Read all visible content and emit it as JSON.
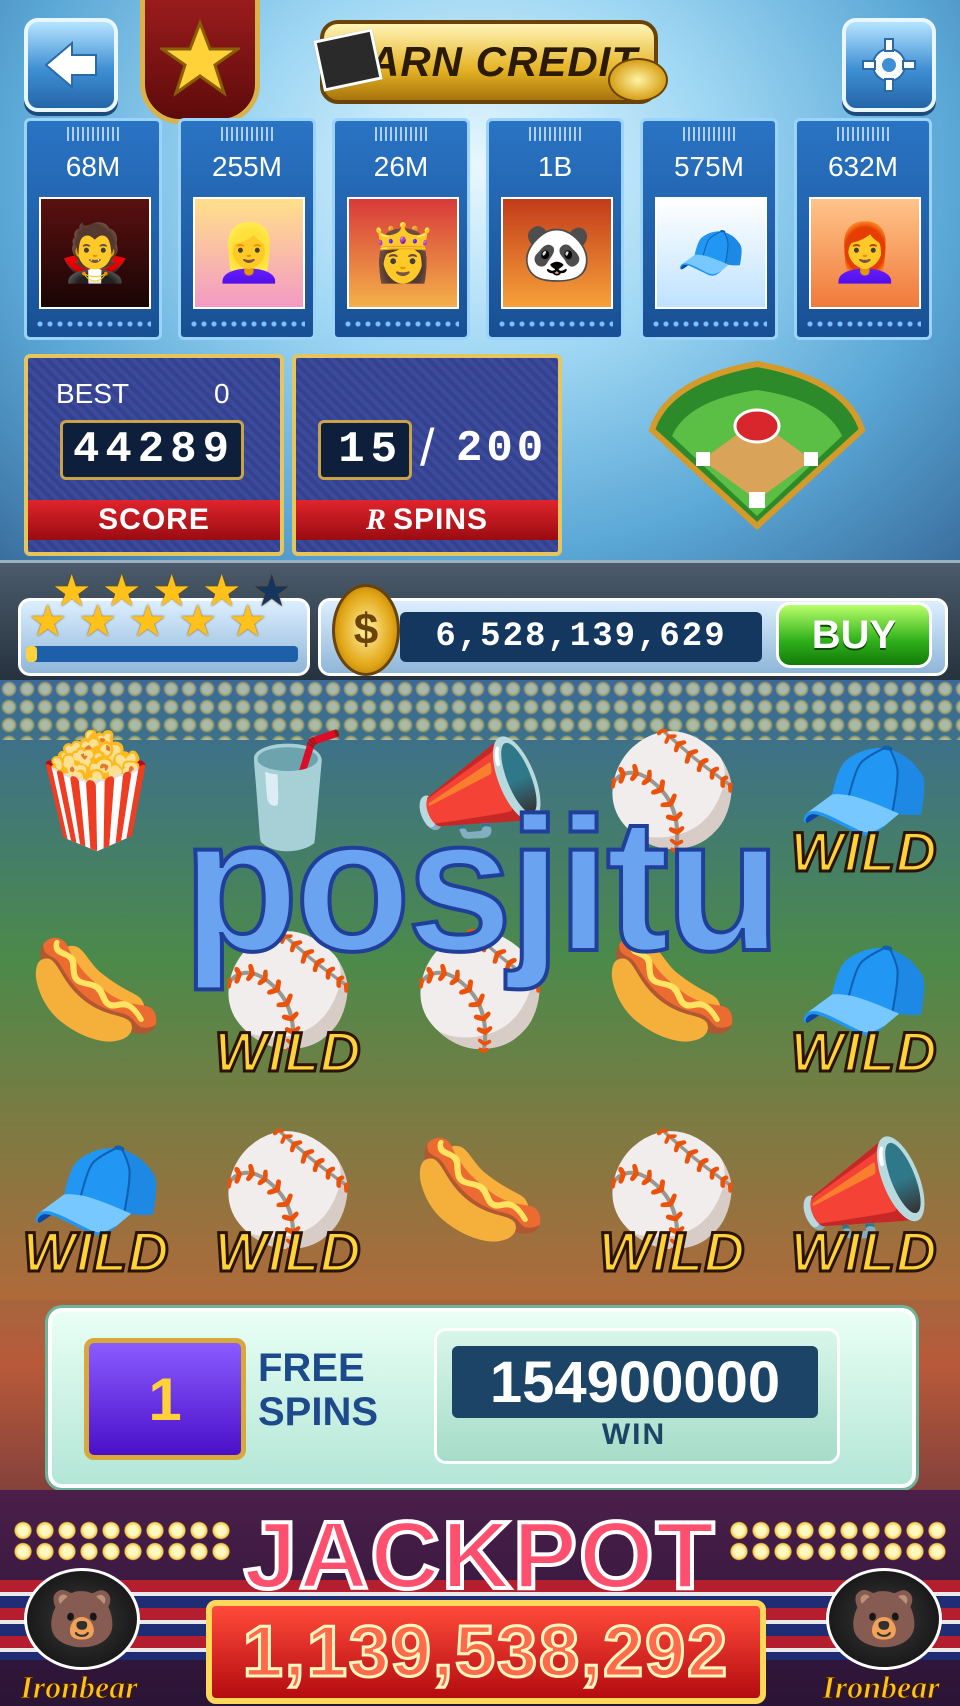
{
  "header": {
    "back_icon": "back-arrow-icon",
    "rank_icon": "star-shield-icon",
    "earn_credit_label": "EARN CREDIT",
    "settings_icon": "gear-icon"
  },
  "players": [
    {
      "amount": "68M",
      "avatar": "vampire-avatar"
    },
    {
      "amount": "255M",
      "avatar": "blonde-girl-avatar"
    },
    {
      "amount": "26M",
      "avatar": "princess-avatar"
    },
    {
      "amount": "1B",
      "avatar": "panda-avatar"
    },
    {
      "amount": "575M",
      "avatar": "baseball-boy-avatar"
    },
    {
      "amount": "632M",
      "avatar": "redhead-girl-avatar"
    }
  ],
  "score": {
    "best_label": "BEST",
    "best_value": "0",
    "value": "44289",
    "label": "SCORE"
  },
  "spins": {
    "current": "15",
    "separator": "/",
    "total": "200",
    "label": "SPINS"
  },
  "level": {
    "stars_filled": 9,
    "stars_total": 10,
    "progress": 0.04
  },
  "credits": {
    "value": "6,528,139,629",
    "buy_label": "BUY"
  },
  "reels": [
    [
      {
        "sym": "🍿"
      },
      {
        "sym": "🥤"
      },
      {
        "sym": "📣"
      },
      {
        "sym": "⚾"
      },
      {
        "sym": "🧢",
        "wild": "WILD"
      }
    ],
    [
      {
        "sym": "🌭"
      },
      {
        "sym": "⚾",
        "wild": "WILD"
      },
      {
        "sym": "⚾"
      },
      {
        "sym": "🌭"
      },
      {
        "sym": "🧢",
        "wild": "WILD"
      }
    ],
    [
      {
        "sym": "🧢",
        "wild": "WILD"
      },
      {
        "sym": "⚾",
        "wild": "WILD"
      },
      {
        "sym": "🌭"
      },
      {
        "sym": "⚾",
        "wild": "WILD"
      },
      {
        "sym": "📣",
        "wild": "WILD"
      }
    ]
  ],
  "watermark": "posjitu",
  "free_spins": {
    "count": "1",
    "label_line1": "FREE",
    "label_line2": "SPINS",
    "win_value": "154900000",
    "win_label": "WIN"
  },
  "jackpot": {
    "title": "JACKPOT",
    "value": "1,139,538,292",
    "brand": "Ironbear"
  }
}
